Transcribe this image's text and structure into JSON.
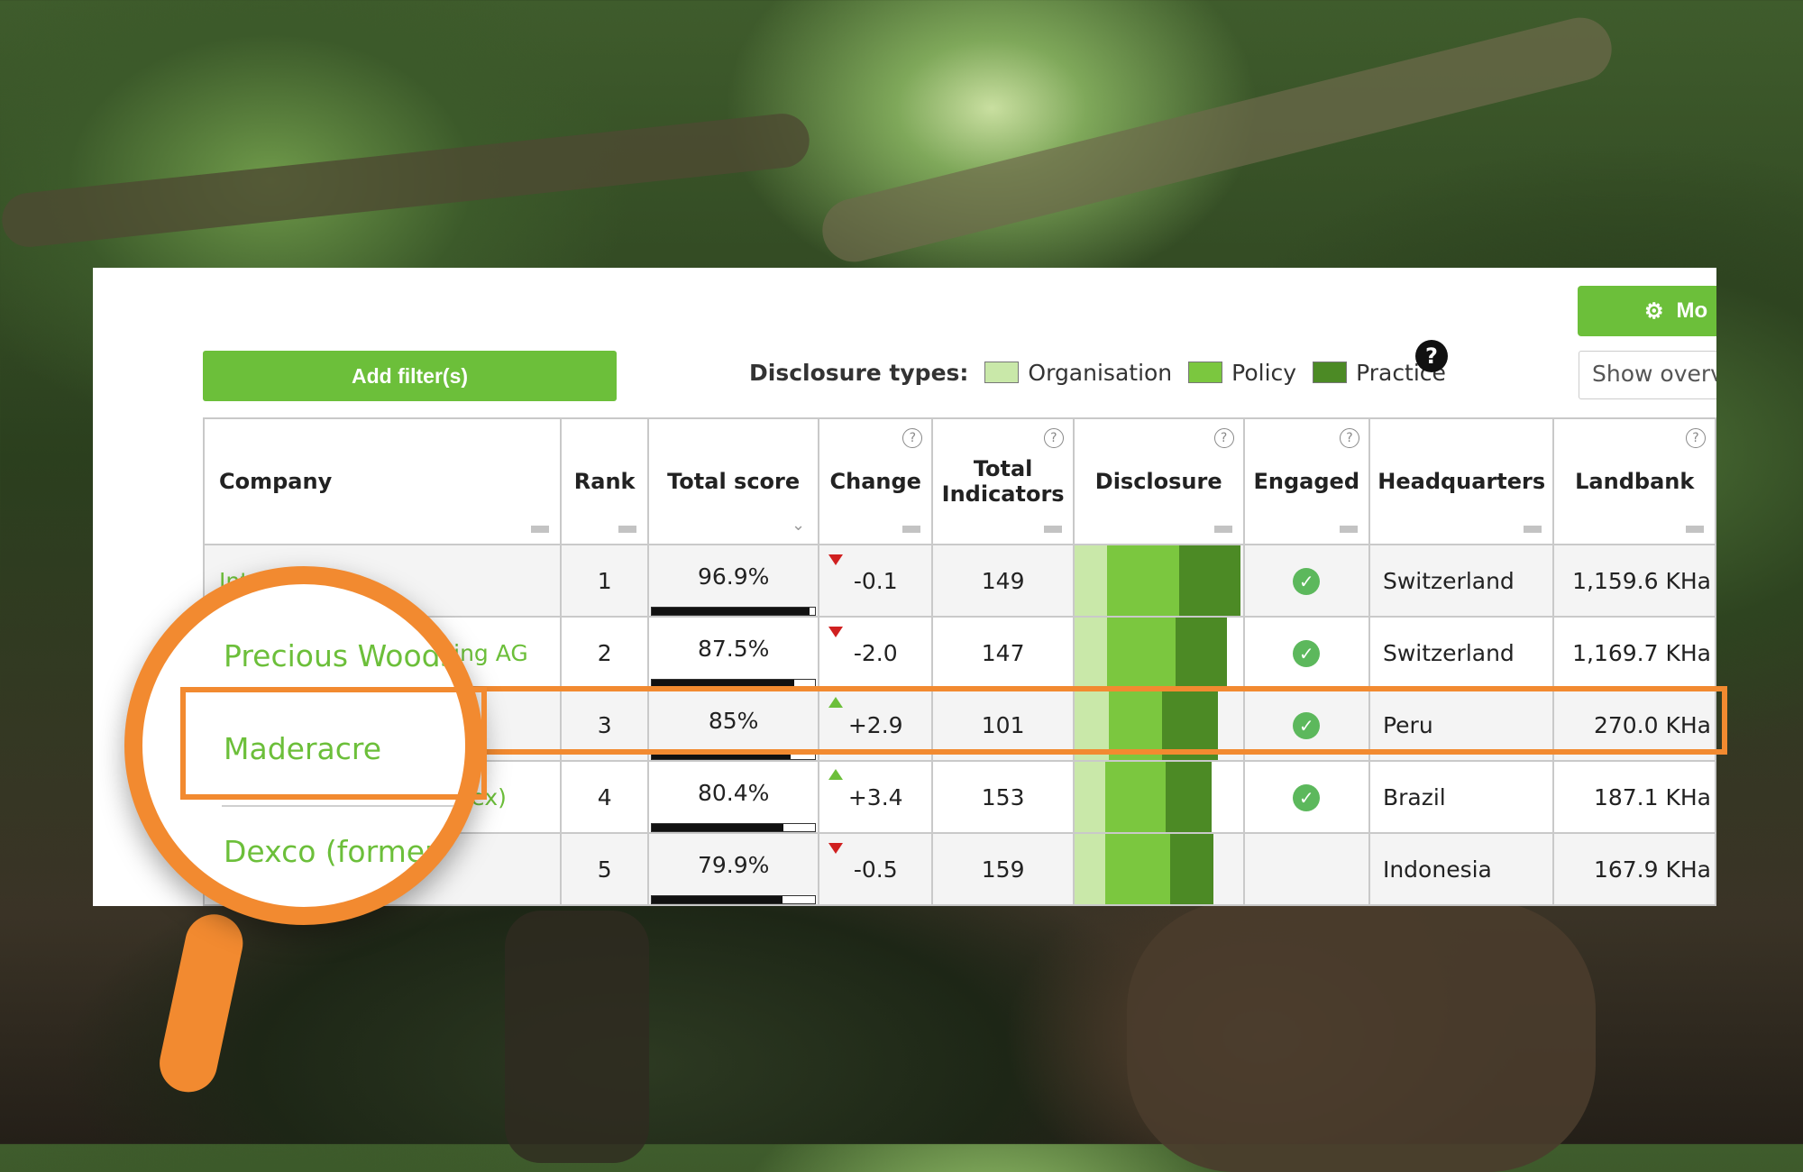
{
  "toolbar": {
    "add_filter_label": "Add filter(s)",
    "mode_button_label": "Mo",
    "show_overview_label": "Show overv",
    "help_label": "?"
  },
  "legend": {
    "label": "Disclosure types:",
    "items": [
      {
        "label": "Organisation",
        "color": "#c9e8a9"
      },
      {
        "label": "Policy",
        "color": "#7bc73f"
      },
      {
        "label": "Practice",
        "color": "#4c8a25"
      }
    ]
  },
  "table": {
    "headers": {
      "company": "Company",
      "rank": "Rank",
      "total_score": "Total score",
      "change": "Change",
      "total_indicators_1": "Total",
      "total_indicators_2": "Indicators",
      "disclosure": "Disclosure",
      "engaged": "Engaged",
      "headquarters": "Headquarters",
      "landbank": "Landbank"
    },
    "rows": [
      {
        "company": "Int",
        "rank": "1",
        "score": "96.9%",
        "score_frac": 0.969,
        "change": "-0.1",
        "dir": "down",
        "indicators": "149",
        "disclosure": [
          0.19,
          0.42,
          0.36
        ],
        "engaged": true,
        "hq": "Switzerland",
        "landbank": "1,159.6 KHa"
      },
      {
        "company": "Precious Woods Holding AG",
        "rank": "2",
        "score": "87.5%",
        "score_frac": 0.875,
        "change": "-2.0",
        "dir": "down",
        "indicators": "147",
        "disclosure": [
          0.19,
          0.4,
          0.3
        ],
        "engaged": true,
        "hq": "Switzerland",
        "landbank": "1,169.7 KHa"
      },
      {
        "company": "Maderacre",
        "rank": "3",
        "score": "85%",
        "score_frac": 0.85,
        "change": "+2.9",
        "dir": "up",
        "indicators": "101",
        "disclosure": [
          0.2,
          0.31,
          0.33
        ],
        "engaged": true,
        "hq": "Peru",
        "landbank": "270.0 KHa"
      },
      {
        "company": "Dexco (formerly Duratex)",
        "rank": "4",
        "score": "80.4%",
        "score_frac": 0.804,
        "change": "+3.4",
        "dir": "up",
        "indicators": "153",
        "disclosure": [
          0.18,
          0.35,
          0.27
        ],
        "engaged": true,
        "hq": "Brazil",
        "landbank": "187.1 KHa"
      },
      {
        "company": "",
        "rank": "5",
        "score": "79.9%",
        "score_frac": 0.799,
        "change": "-0.5",
        "dir": "down",
        "indicators": "159",
        "disclosure": [
          0.18,
          0.38,
          0.25
        ],
        "engaged": false,
        "hq": "Indonesia",
        "landbank": "167.9 KHa"
      }
    ]
  },
  "magnifier": {
    "line1": "Precious Woods",
    "line2": "Maderacre",
    "line3": "Dexco (formerly"
  }
}
